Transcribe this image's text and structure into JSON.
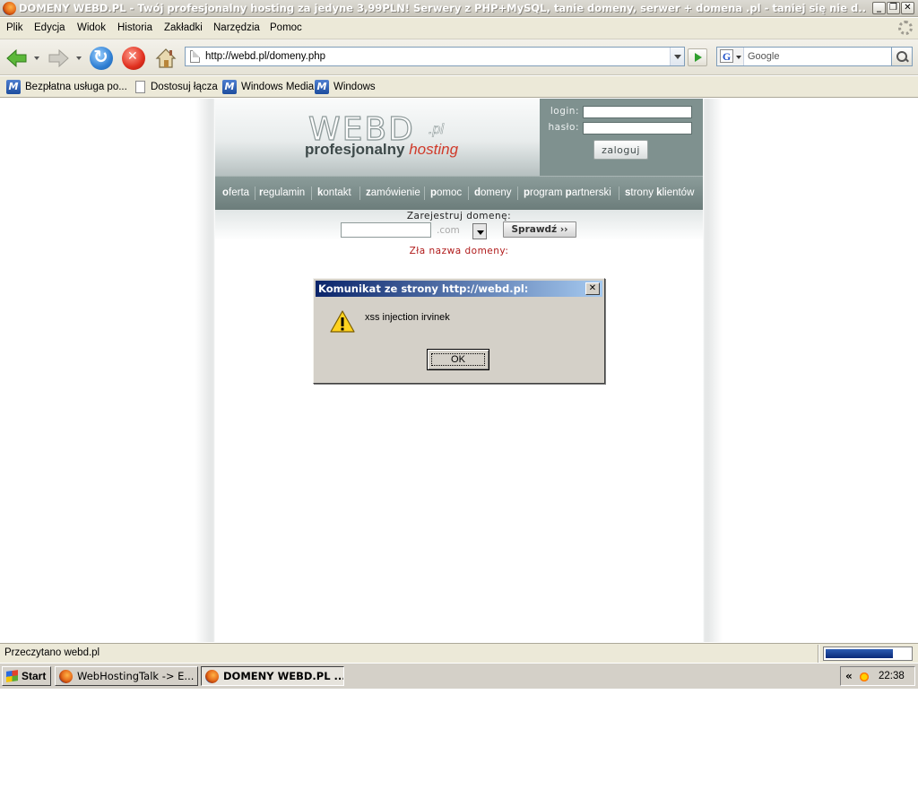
{
  "window": {
    "title_main": "DOMENY WEBD.PL - Twój profesjonalny hosting za jedyne 3,99PLN! Serwery z PHP+MySQL, tanie domeny, serwer + domena .pl - taniej się nie d...",
    "min_glyph": "_",
    "max_glyph": "❐",
    "close_glyph": "✕"
  },
  "menu": [
    "Plik",
    "Edycja",
    "Widok",
    "Historia",
    "Zakładki",
    "Narzędzia",
    "Pomoc"
  ],
  "navbar": {
    "url": "http://webd.pl/domeny.php",
    "search_placeholder": "Google",
    "search_engine_glyph": "G"
  },
  "bookmarks": [
    {
      "label": "Bezpłatna usługa po...",
      "icon": "ms-icon"
    },
    {
      "label": "Dostosuj łącza",
      "icon": "page-icon"
    },
    {
      "label": "Windows Media",
      "icon": "ms-icon"
    },
    {
      "label": "Windows",
      "icon": "ms-icon"
    }
  ],
  "site": {
    "logo": "WEBD",
    "logo_tld": ".pl",
    "tagline_1": "profesjonalny",
    "tagline_2": "hosting",
    "login_label": "login:",
    "password_label": "hasło:",
    "login_button": "zaloguj",
    "nav": [
      {
        "first": "o",
        "rest": "ferta"
      },
      {
        "first": "r",
        "rest": "egulamin"
      },
      {
        "first": "k",
        "rest": "ontakt"
      },
      {
        "first": "z",
        "rest": "amówienie"
      },
      {
        "first": "p",
        "rest": "omoc"
      },
      {
        "first": "d",
        "rest": "omeny"
      },
      {
        "first": "p",
        "rest": "rogram ",
        "first2": "p",
        "rest2": "artnerski"
      },
      {
        "first": "s",
        "rest": "trony ",
        "first2": "k",
        "rest2": "lientów"
      }
    ],
    "domain_label": "Zarejestruj domenę:",
    "domain_value": "",
    "tld_selected": ".com",
    "check_button": "Sprawdź ››",
    "error": "Zła nazwa domeny:"
  },
  "dialog": {
    "title": "Komunikat ze strony http://webd.pl:",
    "message": "xss injection irvinek",
    "ok": "OK",
    "close_glyph": "✕"
  },
  "status": {
    "text": "Przeczytano webd.pl",
    "progress": 0.78
  },
  "taskbar": {
    "start": "Start",
    "tasks": [
      {
        "label": "WebHostingTalk -> E...",
        "active": false
      },
      {
        "label": "DOMENY WEBD.PL ...",
        "active": true
      }
    ],
    "tray_chevron": "«",
    "time": "22:38"
  }
}
